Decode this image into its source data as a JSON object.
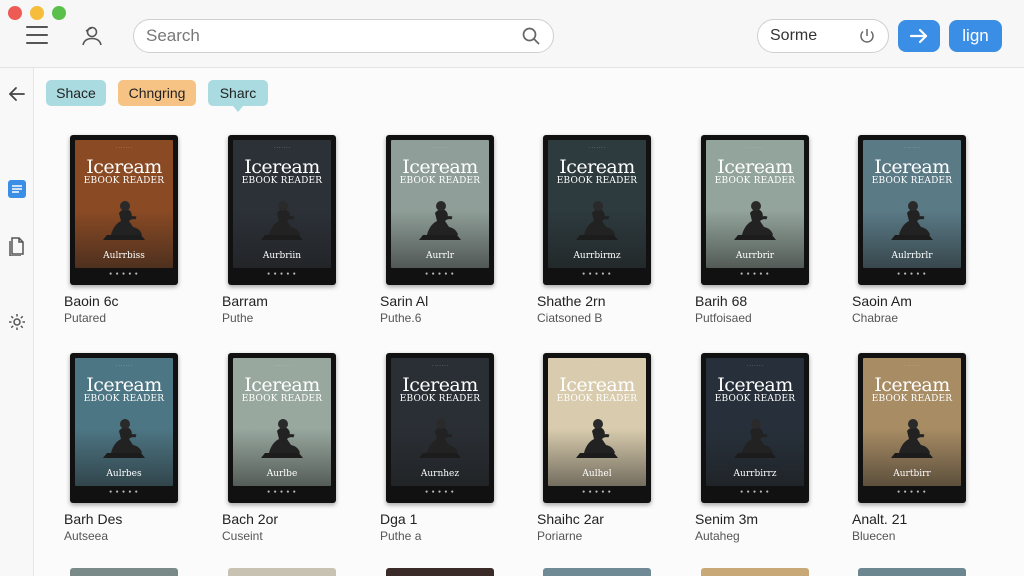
{
  "search": {
    "placeholder": "Search"
  },
  "sort": {
    "label": "Sorme"
  },
  "login": {
    "label": "lign"
  },
  "chips": [
    {
      "label": "Shace",
      "color": "#a9dbe0"
    },
    {
      "label": "Chngring",
      "color": "#f6c384"
    },
    {
      "label": "Sharc",
      "color": "#a9dbe0"
    }
  ],
  "cover_text": {
    "title": "Iceream",
    "subtitle": "EBOOK READER"
  },
  "books": [
    {
      "title": "Baoin 6c",
      "subtitle": "Putared",
      "author": "Aulrrbiss",
      "tone": "#8a4a24"
    },
    {
      "title": "Barram",
      "subtitle": "Puthe",
      "author": "Aurbriin",
      "tone": "#2c3138"
    },
    {
      "title": "Sarin Al",
      "subtitle": "Puthe.6",
      "author": "Aurrlr",
      "tone": "#8f9e98"
    },
    {
      "title": "Shathe 2rn",
      "subtitle": "Ciatsoned B",
      "author": "Aurrbirmz",
      "tone": "#2d3a3e"
    },
    {
      "title": "Barih 68",
      "subtitle": "Putfoisaed",
      "author": "Aurrbrir",
      "tone": "#93a49c"
    },
    {
      "title": "Saoin Am",
      "subtitle": "Chabrae",
      "author": "Aulrrbrlr",
      "tone": "#5a7a86"
    },
    {
      "title": "Barh Des",
      "subtitle": "Autseea",
      "author": "Aulrbes",
      "tone": "#4d7684"
    },
    {
      "title": "Bach 2or",
      "subtitle": "Cuseint",
      "author": "Aurlbe",
      "tone": "#98a89f"
    },
    {
      "title": "Dga 1",
      "subtitle": "Puthe a",
      "author": "Aurnhez",
      "tone": "#2a2f35"
    },
    {
      "title": "Shaihc 2ar",
      "subtitle": "Poriarne",
      "author": "Aulhel",
      "tone": "#d9ccae"
    },
    {
      "title": "Senim 3m",
      "subtitle": "Autaheg",
      "author": "Aurrbirrz",
      "tone": "#27303a"
    },
    {
      "title": "Analt. 21",
      "subtitle": "Bluecen",
      "author": "Aurtbirr",
      "tone": "#a88c64"
    }
  ]
}
